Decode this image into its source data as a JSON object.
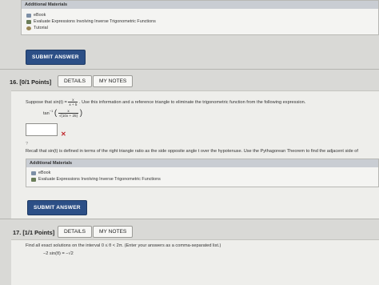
{
  "top_materials": {
    "heading": "Additional Materials",
    "items": [
      {
        "label": "eBook",
        "icon": "ebook-icon"
      },
      {
        "label": "Evaluate Expressions Involving Inverse Trigonometric Functions",
        "icon": "document-icon"
      },
      {
        "label": "Tutorial",
        "icon": "tutorial-icon"
      }
    ]
  },
  "submit_label": "SUBMIT ANSWER",
  "q16": {
    "number": "16.",
    "points": "[0/1 Points]",
    "details_label": "DETAILS",
    "my_notes_label": "MY NOTES",
    "prompt_prefix": "Suppose that",
    "prompt_func": "sin(t) =",
    "frac_num": "x",
    "frac_den": "x + 5",
    "prompt_suffix": ". Use this information and a reference triangle to eliminate the trigonometric function from the following expression.",
    "expr_prefix": "tan",
    "expr_exp": "−1",
    "expr_num": "x",
    "expr_den": "√(10x + 25)",
    "answer_value": "",
    "result_mark": "✕",
    "hint_marker": "?",
    "hint": "Recall that sin(t) is defined in terms of the right triangle ratio as the side opposite angle t over the hypotenuse. Use the Pythagorean Theorem to find the adjacent side of",
    "materials": {
      "heading": "Additional Materials",
      "items": [
        {
          "label": "eBook",
          "icon": "ebook-icon"
        },
        {
          "label": "Evaluate Expressions Involving Inverse Trigonometric Functions",
          "icon": "document-icon"
        }
      ]
    }
  },
  "q17": {
    "number": "17.",
    "points": "[1/1 Points]",
    "details_label": "DETAILS",
    "my_notes_label": "MY NOTES",
    "prompt": "Find all exact solutions on the interval  0 ≤ θ < 2π.  (Enter your answers as a comma-separated list.)",
    "equation": "−2 sin(θ) = −√2"
  },
  "colors": {
    "submit_bg": "#2c4f86",
    "materials_header_bg": "#c9cdd3",
    "error_red": "#c0282d"
  }
}
